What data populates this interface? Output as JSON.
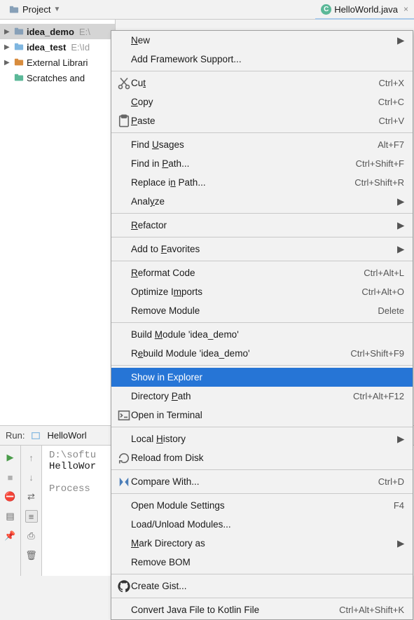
{
  "toolbar": {
    "project_label": "Project"
  },
  "tab": {
    "filename": "HelloWorld.java"
  },
  "tree": {
    "items": [
      {
        "label": "idea_demo",
        "path": "E:\\",
        "bold": true,
        "selected": true,
        "arrow": "▶",
        "iconColor": "#87a0b8"
      },
      {
        "label": "idea_test",
        "path": "E:\\Id",
        "bold": true,
        "selected": false,
        "arrow": "▶",
        "iconColor": "#7fb6e0"
      },
      {
        "label": "External Librari",
        "path": "",
        "bold": false,
        "selected": false,
        "arrow": "▶",
        "iconColor": "#d88c3d"
      },
      {
        "label": "Scratches and",
        "path": "",
        "bold": false,
        "selected": false,
        "arrow": "",
        "iconColor": "#5bb898"
      }
    ]
  },
  "menu": {
    "groups": [
      [
        {
          "label": "New",
          "u": 0,
          "submenu": true
        },
        {
          "label": "Add Framework Support..."
        }
      ],
      [
        {
          "label": "Cut",
          "u": 2,
          "icon": "cut",
          "shortcut": "Ctrl+X"
        },
        {
          "label": "Copy",
          "u": 0,
          "shortcut": "Ctrl+C"
        },
        {
          "label": "Paste",
          "u": 0,
          "icon": "paste",
          "shortcut": "Ctrl+V"
        }
      ],
      [
        {
          "label": "Find Usages",
          "u": 5,
          "shortcut": "Alt+F7"
        },
        {
          "label": "Find in Path...",
          "u": 8,
          "shortcut": "Ctrl+Shift+F"
        },
        {
          "label": "Replace in Path...",
          "u": 9,
          "shortcut": "Ctrl+Shift+R"
        },
        {
          "label": "Analyze",
          "u": 4,
          "submenu": true
        }
      ],
      [
        {
          "label": "Refactor",
          "u": 0,
          "submenu": true
        }
      ],
      [
        {
          "label": "Add to Favorites",
          "u": 7,
          "submenu": true
        }
      ],
      [
        {
          "label": "Reformat Code",
          "u": 0,
          "shortcut": "Ctrl+Alt+L"
        },
        {
          "label": "Optimize Imports",
          "u": 10,
          "shortcut": "Ctrl+Alt+O"
        },
        {
          "label": "Remove Module",
          "shortcut": "Delete"
        }
      ],
      [
        {
          "label": "Build Module 'idea_demo'",
          "u": 6
        },
        {
          "label": "Rebuild Module 'idea_demo'",
          "u": 1,
          "shortcut": "Ctrl+Shift+F9"
        }
      ],
      [
        {
          "label": "Show in Explorer",
          "selected": true
        },
        {
          "label": "Directory Path",
          "u": 10,
          "shortcut": "Ctrl+Alt+F12"
        },
        {
          "label": "Open in Terminal",
          "icon": "terminal"
        }
      ],
      [
        {
          "label": "Local History",
          "u": 6,
          "submenu": true
        },
        {
          "label": "Reload from Disk",
          "icon": "reload"
        }
      ],
      [
        {
          "label": "Compare With...",
          "icon": "compare",
          "shortcut": "Ctrl+D"
        }
      ],
      [
        {
          "label": "Open Module Settings",
          "shortcut": "F4"
        },
        {
          "label": "Load/Unload Modules..."
        },
        {
          "label": "Mark Directory as",
          "u": 0,
          "submenu": true
        },
        {
          "label": "Remove BOM"
        }
      ],
      [
        {
          "label": "Create Gist...",
          "icon": "github"
        }
      ],
      [
        {
          "label": "Convert Java File to Kotlin File",
          "shortcut": "Ctrl+Alt+Shift+K"
        }
      ]
    ]
  },
  "run": {
    "header_label": "Run:",
    "config_label": "HelloWorl",
    "console_line1": "D:\\softu",
    "console_line2": "HelloWor",
    "console_line3": "Process"
  }
}
